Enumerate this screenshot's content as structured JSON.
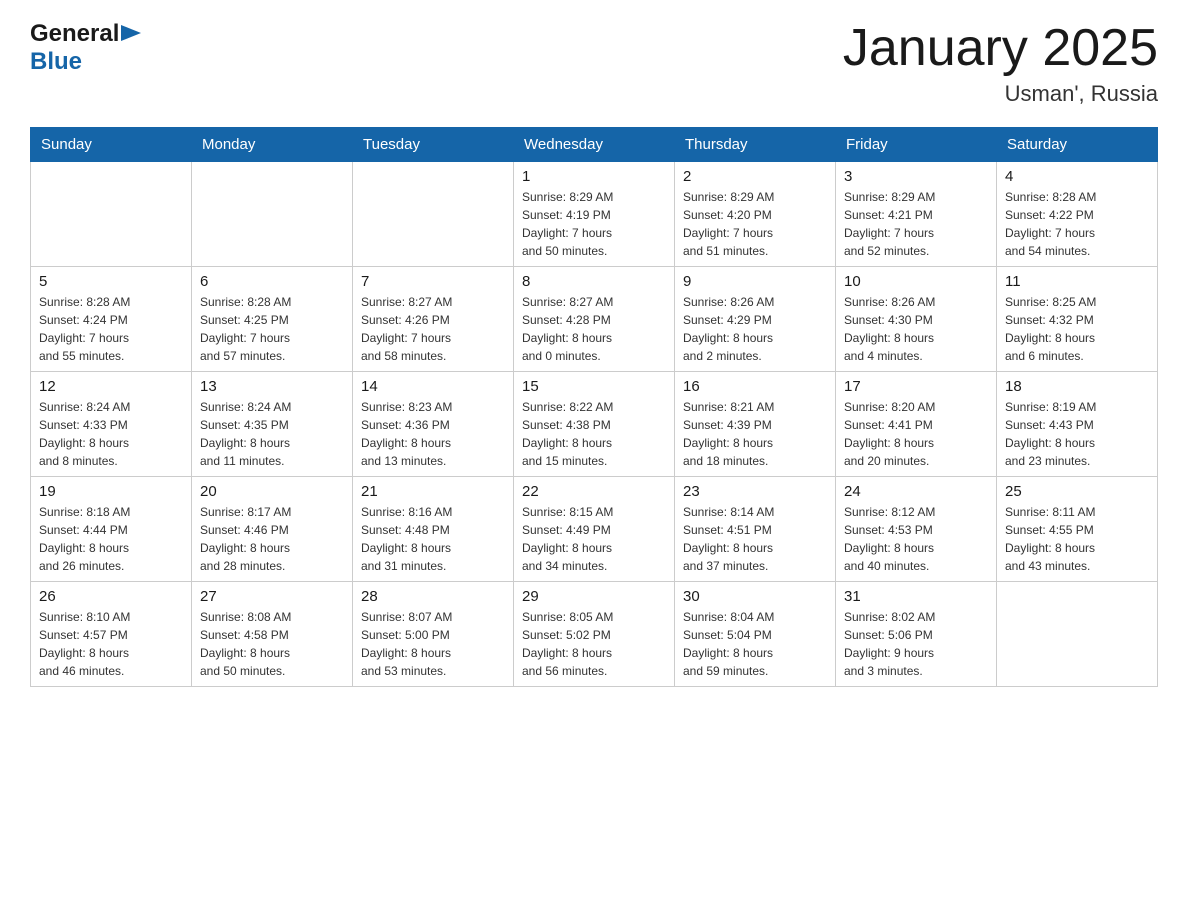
{
  "header": {
    "logo": {
      "general": "General",
      "triangle": "▶",
      "blue": "Blue"
    },
    "title": "January 2025",
    "subtitle": "Usman', Russia"
  },
  "calendar": {
    "headers": [
      "Sunday",
      "Monday",
      "Tuesday",
      "Wednesday",
      "Thursday",
      "Friday",
      "Saturday"
    ],
    "weeks": [
      [
        {
          "day": "",
          "info": ""
        },
        {
          "day": "",
          "info": ""
        },
        {
          "day": "",
          "info": ""
        },
        {
          "day": "1",
          "info": "Sunrise: 8:29 AM\nSunset: 4:19 PM\nDaylight: 7 hours\nand 50 minutes."
        },
        {
          "day": "2",
          "info": "Sunrise: 8:29 AM\nSunset: 4:20 PM\nDaylight: 7 hours\nand 51 minutes."
        },
        {
          "day": "3",
          "info": "Sunrise: 8:29 AM\nSunset: 4:21 PM\nDaylight: 7 hours\nand 52 minutes."
        },
        {
          "day": "4",
          "info": "Sunrise: 8:28 AM\nSunset: 4:22 PM\nDaylight: 7 hours\nand 54 minutes."
        }
      ],
      [
        {
          "day": "5",
          "info": "Sunrise: 8:28 AM\nSunset: 4:24 PM\nDaylight: 7 hours\nand 55 minutes."
        },
        {
          "day": "6",
          "info": "Sunrise: 8:28 AM\nSunset: 4:25 PM\nDaylight: 7 hours\nand 57 minutes."
        },
        {
          "day": "7",
          "info": "Sunrise: 8:27 AM\nSunset: 4:26 PM\nDaylight: 7 hours\nand 58 minutes."
        },
        {
          "day": "8",
          "info": "Sunrise: 8:27 AM\nSunset: 4:28 PM\nDaylight: 8 hours\nand 0 minutes."
        },
        {
          "day": "9",
          "info": "Sunrise: 8:26 AM\nSunset: 4:29 PM\nDaylight: 8 hours\nand 2 minutes."
        },
        {
          "day": "10",
          "info": "Sunrise: 8:26 AM\nSunset: 4:30 PM\nDaylight: 8 hours\nand 4 minutes."
        },
        {
          "day": "11",
          "info": "Sunrise: 8:25 AM\nSunset: 4:32 PM\nDaylight: 8 hours\nand 6 minutes."
        }
      ],
      [
        {
          "day": "12",
          "info": "Sunrise: 8:24 AM\nSunset: 4:33 PM\nDaylight: 8 hours\nand 8 minutes."
        },
        {
          "day": "13",
          "info": "Sunrise: 8:24 AM\nSunset: 4:35 PM\nDaylight: 8 hours\nand 11 minutes."
        },
        {
          "day": "14",
          "info": "Sunrise: 8:23 AM\nSunset: 4:36 PM\nDaylight: 8 hours\nand 13 minutes."
        },
        {
          "day": "15",
          "info": "Sunrise: 8:22 AM\nSunset: 4:38 PM\nDaylight: 8 hours\nand 15 minutes."
        },
        {
          "day": "16",
          "info": "Sunrise: 8:21 AM\nSunset: 4:39 PM\nDaylight: 8 hours\nand 18 minutes."
        },
        {
          "day": "17",
          "info": "Sunrise: 8:20 AM\nSunset: 4:41 PM\nDaylight: 8 hours\nand 20 minutes."
        },
        {
          "day": "18",
          "info": "Sunrise: 8:19 AM\nSunset: 4:43 PM\nDaylight: 8 hours\nand 23 minutes."
        }
      ],
      [
        {
          "day": "19",
          "info": "Sunrise: 8:18 AM\nSunset: 4:44 PM\nDaylight: 8 hours\nand 26 minutes."
        },
        {
          "day": "20",
          "info": "Sunrise: 8:17 AM\nSunset: 4:46 PM\nDaylight: 8 hours\nand 28 minutes."
        },
        {
          "day": "21",
          "info": "Sunrise: 8:16 AM\nSunset: 4:48 PM\nDaylight: 8 hours\nand 31 minutes."
        },
        {
          "day": "22",
          "info": "Sunrise: 8:15 AM\nSunset: 4:49 PM\nDaylight: 8 hours\nand 34 minutes."
        },
        {
          "day": "23",
          "info": "Sunrise: 8:14 AM\nSunset: 4:51 PM\nDaylight: 8 hours\nand 37 minutes."
        },
        {
          "day": "24",
          "info": "Sunrise: 8:12 AM\nSunset: 4:53 PM\nDaylight: 8 hours\nand 40 minutes."
        },
        {
          "day": "25",
          "info": "Sunrise: 8:11 AM\nSunset: 4:55 PM\nDaylight: 8 hours\nand 43 minutes."
        }
      ],
      [
        {
          "day": "26",
          "info": "Sunrise: 8:10 AM\nSunset: 4:57 PM\nDaylight: 8 hours\nand 46 minutes."
        },
        {
          "day": "27",
          "info": "Sunrise: 8:08 AM\nSunset: 4:58 PM\nDaylight: 8 hours\nand 50 minutes."
        },
        {
          "day": "28",
          "info": "Sunrise: 8:07 AM\nSunset: 5:00 PM\nDaylight: 8 hours\nand 53 minutes."
        },
        {
          "day": "29",
          "info": "Sunrise: 8:05 AM\nSunset: 5:02 PM\nDaylight: 8 hours\nand 56 minutes."
        },
        {
          "day": "30",
          "info": "Sunrise: 8:04 AM\nSunset: 5:04 PM\nDaylight: 8 hours\nand 59 minutes."
        },
        {
          "day": "31",
          "info": "Sunrise: 8:02 AM\nSunset: 5:06 PM\nDaylight: 9 hours\nand 3 minutes."
        },
        {
          "day": "",
          "info": ""
        }
      ]
    ]
  }
}
